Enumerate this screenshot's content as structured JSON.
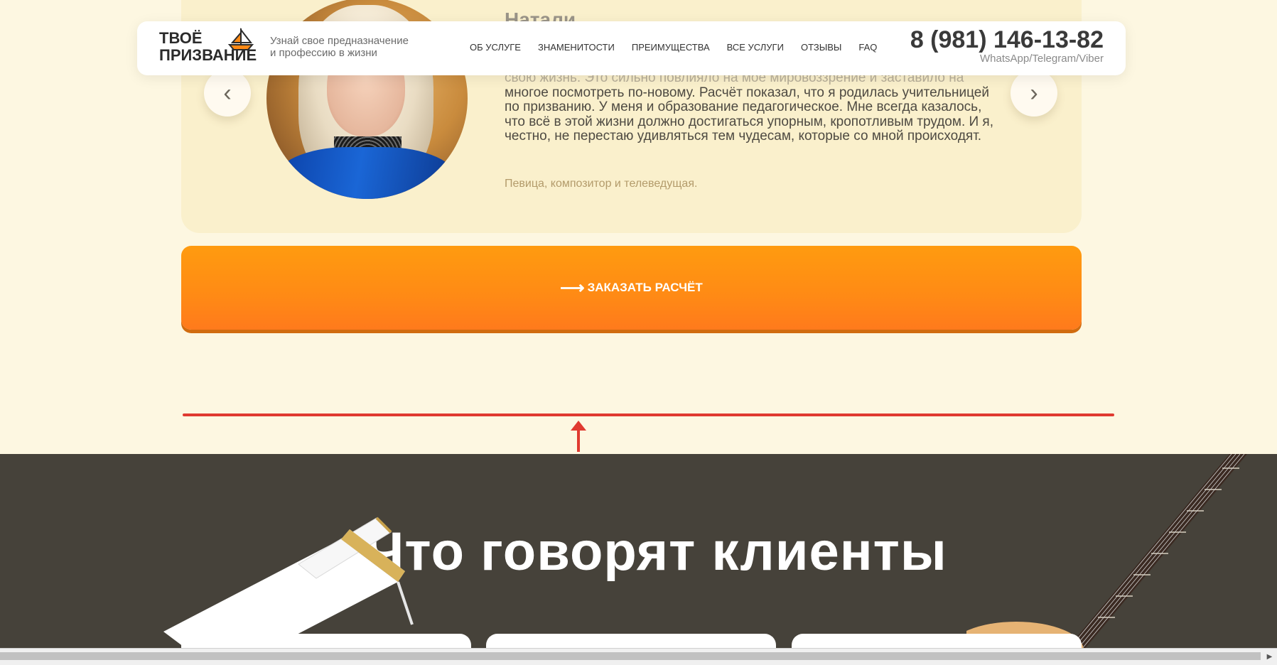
{
  "header": {
    "logo_line1": "ТВОЁ",
    "logo_line2": "ПРИЗВАНИЕ",
    "tagline_line1": "Узнай свое предназначение",
    "tagline_line2": "и профессию в жизни",
    "nav": [
      "ОБ УСЛУГЕ",
      "ЗНАМЕНИТОСТИ",
      "ПРЕИМУЩЕСТВА",
      "ВСЕ УСЛУГИ",
      "ОТЗЫВЫ",
      "FAQ"
    ],
    "phone": "8 (981) 146-13-82",
    "messengers": "WhatsApp/Telegram/Viber"
  },
  "testimonial": {
    "name": "Натали",
    "quote_faded": "свою жизнь. Это сильно повлияло на моё мировоззрение и заставило на",
    "quote": "многое посмотреть по-новому. Расчёт показал, что я родилась учительницей по призванию. У меня и образование педагогическое. Мне всегда казалось, что всё в этой жизни должно достигаться упорным, кропотливым трудом. И я, честно, не перестаю удивляться тем чудесам, которые со мной происходят.",
    "role": "Певица, композитор и телеведущая.",
    "prev_icon": "‹",
    "next_icon": "›"
  },
  "cta": {
    "label": "ЗАКАЗАТЬ РАСЧЁТ",
    "icon": "⟶"
  },
  "reviews_section": {
    "title": "Что говорят клиенты"
  },
  "colors": {
    "background": "#fdf7e1",
    "card": "#faf0cc",
    "accent_orange": "#ff8a15",
    "dark_section": "#46423a",
    "annotation_red": "#e03a30"
  }
}
